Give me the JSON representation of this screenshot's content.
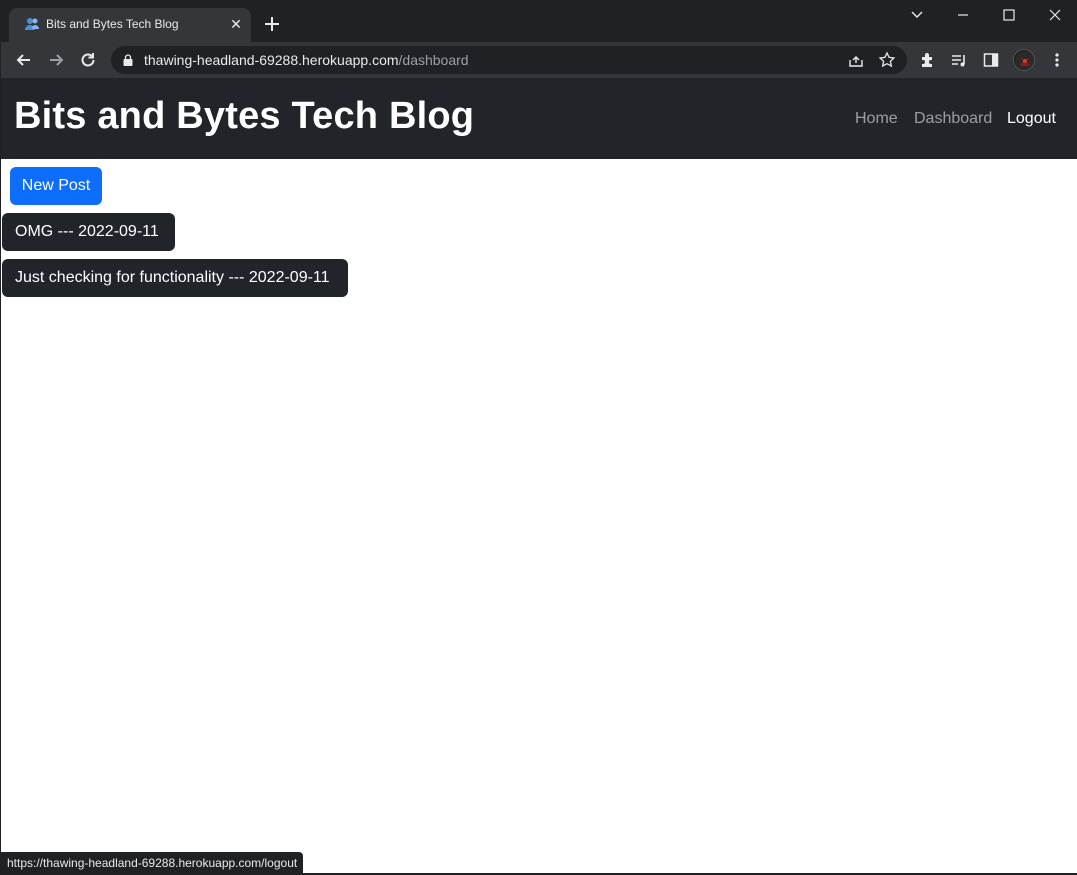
{
  "browser": {
    "tab_title": "Bits and Bytes Tech Blog",
    "tab_close": "✕",
    "url_host": "thawing-headland-69288.herokuapp.com",
    "url_path": "/dashboard",
    "status_url": "https://thawing-headland-69288.herokuapp.com/logout",
    "chrome_colors": {
      "tabstrip": "#202124",
      "toolbar": "#35363a"
    }
  },
  "navbar": {
    "brand": "Bits and Bytes Tech Blog",
    "links": [
      {
        "label": "Home"
      },
      {
        "label": "Dashboard"
      },
      {
        "label": "Logout"
      }
    ],
    "bg_color": "#212529"
  },
  "main": {
    "new_post_label": "New Post",
    "new_post_color": "#0d6efd",
    "posts": [
      {
        "label": "OMG --- 2022-09-11"
      },
      {
        "label": "Just checking for functionality --- 2022-09-11"
      }
    ]
  },
  "icons": [
    "favicon-users-icon",
    "close-icon",
    "plus-icon",
    "chevron-down-icon",
    "minimize-icon",
    "maximize-icon",
    "close-window-icon",
    "back-icon",
    "forward-icon",
    "reload-icon",
    "lock-icon",
    "share-icon",
    "star-icon",
    "extensions-icon",
    "reading-list-icon",
    "side-panel-icon",
    "profile-avatar",
    "menu-dots-icon"
  ]
}
